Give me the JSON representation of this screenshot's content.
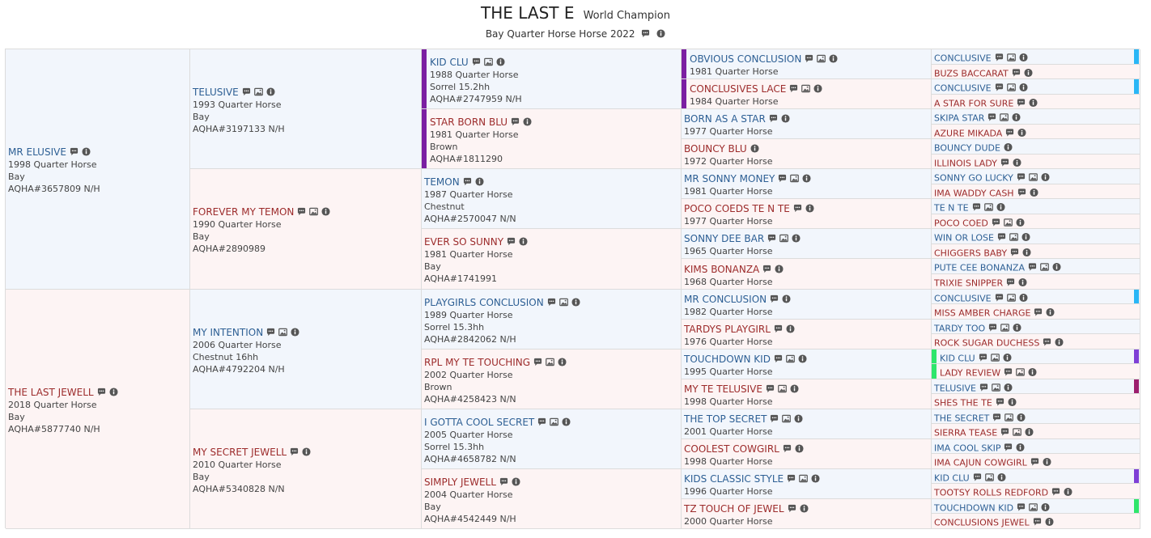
{
  "header": {
    "title": "THE LAST E",
    "tag": "World Champion",
    "description": "Bay Quarter Horse Horse 2022"
  },
  "icons": {
    "comment": "speech-bubble-icon",
    "photo": "photo-icon",
    "info": "info-circle-icon"
  },
  "colors": {
    "sire_bg": "#f2f6fc",
    "dam_bg": "#fdf4f4",
    "sire_text": "#2d5f94",
    "dam_text": "#9c2b2b",
    "border": "#dcdcdc",
    "marker_purple": "#7b1fa2",
    "marker_cyan": "#29b6f6",
    "marker_green": "#2ee66b",
    "marker_violet": "#7e3fd6",
    "marker_magenta": "#9c1f6e"
  },
  "pedigree": [
    [
      {
        "name": "MR ELUSIVE",
        "lines": [
          "1998 Quarter Horse",
          "Bay",
          "AQHA#3657809 N/H"
        ],
        "photo": false
      },
      {
        "name": "THE LAST JEWELL",
        "lines": [
          "2018 Quarter Horse",
          "Bay",
          "AQHA#5877740 N/H"
        ],
        "photo": false
      }
    ],
    [
      {
        "name": "TELUSIVE",
        "lines": [
          "1993 Quarter Horse",
          "Bay",
          "AQHA#3197133 N/H"
        ],
        "photo": true
      },
      {
        "name": "FOREVER MY TEMON",
        "lines": [
          "1990 Quarter Horse",
          "Bay",
          "AQHA#2890989"
        ],
        "photo": true
      },
      {
        "name": "MY INTENTION",
        "lines": [
          "2006 Quarter Horse",
          "Chestnut 16hh",
          "AQHA#4792204 N/H"
        ],
        "photo": true
      },
      {
        "name": "MY SECRET JEWELL",
        "lines": [
          "2010 Quarter Horse",
          "Bay",
          "AQHA#5340828 N/N"
        ],
        "photo": false
      }
    ],
    [
      {
        "name": "KID CLU",
        "lines": [
          "1988 Quarter Horse",
          "Sorrel 15.2hh",
          "AQHA#2747959 N/H"
        ],
        "photo": true,
        "left_bar": "#7b1fa2"
      },
      {
        "name": "STAR BORN BLU",
        "lines": [
          "1981 Quarter Horse",
          "Brown",
          "AQHA#1811290"
        ],
        "photo": false,
        "left_bar": "#7b1fa2"
      },
      {
        "name": "TEMON",
        "lines": [
          "1987 Quarter Horse",
          "Chestnut",
          "AQHA#2570047 N/N"
        ],
        "photo": false
      },
      {
        "name": "EVER SO SUNNY",
        "lines": [
          "1981 Quarter Horse",
          "Bay",
          "AQHA#1741991"
        ],
        "photo": false
      },
      {
        "name": "PLAYGIRLS CONCLUSION",
        "lines": [
          "1989 Quarter Horse",
          "Sorrel 15.3hh",
          "AQHA#2842062 N/H"
        ],
        "photo": true
      },
      {
        "name": "RPL MY TE TOUCHING",
        "lines": [
          "2002 Quarter Horse",
          "Brown",
          "AQHA#4258423 N/N"
        ],
        "photo": true
      },
      {
        "name": "I GOTTA COOL SECRET",
        "lines": [
          "2005 Quarter Horse",
          "Sorrel 15.3hh",
          "AQHA#4658782 N/N"
        ],
        "photo": true
      },
      {
        "name": "SIMPLY JEWELL",
        "lines": [
          "2004 Quarter Horse",
          "Bay",
          "AQHA#4542449 N/H"
        ],
        "photo": false
      }
    ],
    [
      {
        "name": "OBVIOUS CONCLUSION",
        "lines": [
          "1981 Quarter Horse"
        ],
        "photo": true,
        "left_bar": "#7b1fa2"
      },
      {
        "name": "CONCLUSIVES LACE",
        "lines": [
          "1984 Quarter Horse"
        ],
        "photo": true,
        "left_bar": "#7b1fa2"
      },
      {
        "name": "BORN AS A STAR",
        "lines": [
          "1977 Quarter Horse"
        ],
        "photo": false
      },
      {
        "name": "BOUNCY BLU",
        "lines": [
          "1972 Quarter Horse"
        ],
        "photo": false,
        "nocomment": true
      },
      {
        "name": "MR SONNY MONEY",
        "lines": [
          "1981 Quarter Horse"
        ],
        "photo": true
      },
      {
        "name": "POCO COEDS TE N TE",
        "lines": [
          "1977 Quarter Horse"
        ],
        "photo": false
      },
      {
        "name": "SONNY DEE BAR",
        "lines": [
          "1965 Quarter Horse"
        ],
        "photo": true
      },
      {
        "name": "KIMS BONANZA",
        "lines": [
          "1968 Quarter Horse"
        ],
        "photo": false
      },
      {
        "name": "MR CONCLUSION",
        "lines": [
          "1982 Quarter Horse"
        ],
        "photo": false
      },
      {
        "name": "TARDYS PLAYGIRL",
        "lines": [
          "1976 Quarter Horse"
        ],
        "photo": false
      },
      {
        "name": "TOUCHDOWN KID",
        "lines": [
          "1995 Quarter Horse"
        ],
        "photo": true
      },
      {
        "name": "MY TE TELUSIVE",
        "lines": [
          "1998 Quarter Horse"
        ],
        "photo": true
      },
      {
        "name": "THE TOP SECRET",
        "lines": [
          "2001 Quarter Horse"
        ],
        "photo": true
      },
      {
        "name": "COOLEST COWGIRL",
        "lines": [
          "1998 Quarter Horse"
        ],
        "photo": false
      },
      {
        "name": "KIDS CLASSIC STYLE",
        "lines": [
          "1996 Quarter Horse"
        ],
        "photo": true
      },
      {
        "name": "TZ TOUCH OF JEWEL",
        "lines": [
          "2000 Quarter Horse"
        ],
        "photo": false
      }
    ],
    [
      {
        "name": "CONCLUSIVE",
        "photo": true,
        "right_bar": "#29b6f6"
      },
      {
        "name": "BUZS BACCARAT",
        "photo": false
      },
      {
        "name": "CONCLUSIVE",
        "photo": true,
        "right_bar": "#29b6f6"
      },
      {
        "name": "A STAR FOR SURE",
        "photo": false
      },
      {
        "name": "SKIPA STAR",
        "photo": true
      },
      {
        "name": "AZURE MIKADA",
        "photo": false
      },
      {
        "name": "BOUNCY DUDE",
        "photo": false,
        "nocomment": true
      },
      {
        "name": "ILLINOIS LADY",
        "photo": false
      },
      {
        "name": "SONNY GO LUCKY",
        "photo": true
      },
      {
        "name": "IMA WADDY CASH",
        "photo": false
      },
      {
        "name": "TE N TE",
        "photo": true
      },
      {
        "name": "POCO COED",
        "photo": true
      },
      {
        "name": "WIN OR LOSE",
        "photo": true
      },
      {
        "name": "CHIGGERS BABY",
        "photo": false
      },
      {
        "name": "PUTE CEE BONANZA",
        "photo": true
      },
      {
        "name": "TRIXIE SNIPPER",
        "photo": false
      },
      {
        "name": "CONCLUSIVE",
        "photo": true,
        "right_bar": "#29b6f6"
      },
      {
        "name": "MISS AMBER CHARGE",
        "photo": false
      },
      {
        "name": "TARDY TOO",
        "photo": true
      },
      {
        "name": "ROCK SUGAR DUCHESS",
        "photo": false
      },
      {
        "name": "KID CLU",
        "photo": true,
        "left_bar": "#2ee66b",
        "right_bar": "#7e3fd6"
      },
      {
        "name": "LADY REVIEW",
        "photo": true,
        "left_bar": "#2ee66b"
      },
      {
        "name": "TELUSIVE",
        "photo": true,
        "right_bar": "#9c1f6e"
      },
      {
        "name": "SHES THE TE",
        "photo": false
      },
      {
        "name": "THE SECRET",
        "photo": true
      },
      {
        "name": "SIERRA TEASE",
        "photo": true
      },
      {
        "name": "IMA COOL SKIP",
        "photo": false
      },
      {
        "name": "IMA CAJUN COWGIRL",
        "photo": false
      },
      {
        "name": "KID CLU",
        "photo": true,
        "right_bar": "#7e3fd6"
      },
      {
        "name": "TOOTSY ROLLS REDFORD",
        "photo": false
      },
      {
        "name": "TOUCHDOWN KID",
        "photo": true,
        "right_bar": "#2ee66b"
      },
      {
        "name": "CONCLUSIONS JEWEL",
        "photo": false
      }
    ]
  ]
}
